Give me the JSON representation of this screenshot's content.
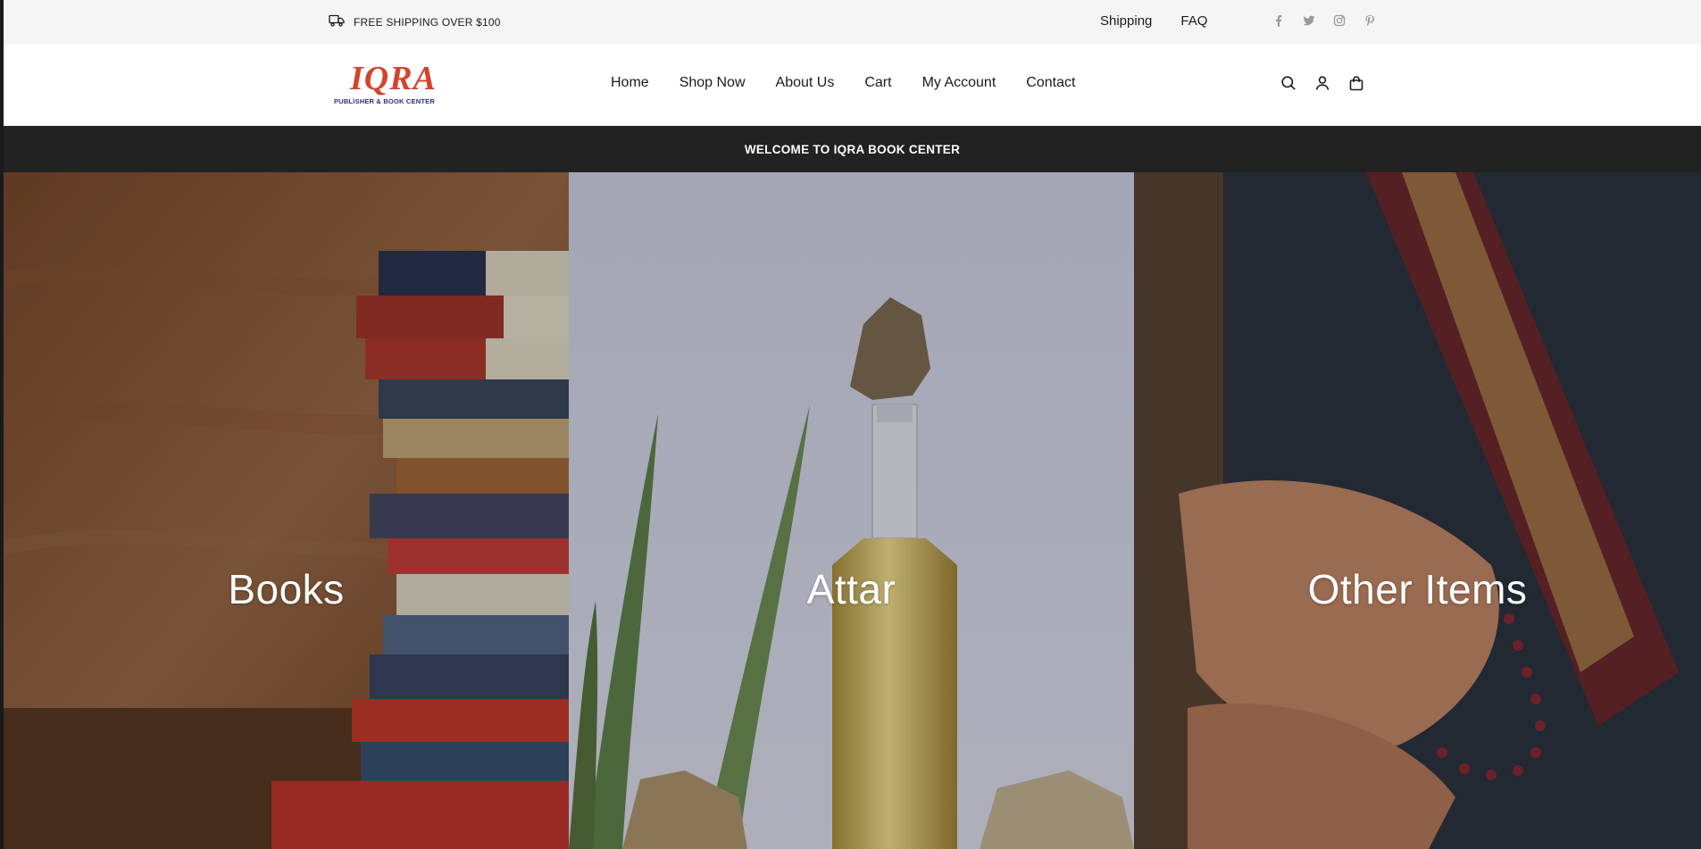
{
  "topbar": {
    "shipping_text": "FREE SHIPPING OVER $100",
    "links": [
      "Shipping",
      "FAQ"
    ],
    "social_icons": [
      "facebook-icon",
      "twitter-icon",
      "instagram-icon",
      "pinterest-icon"
    ]
  },
  "header": {
    "logo_word": "IQRA",
    "logo_sub": "PUBLISHER & BOOK CENTER",
    "nav": [
      "Home",
      "Shop Now",
      "About Us",
      "Cart",
      "My Account",
      "Contact"
    ],
    "icons": [
      "search-icon",
      "account-icon",
      "bag-icon"
    ]
  },
  "welcome": {
    "text": "WELCOME TO IQRA BOOK CENTER"
  },
  "tiles": [
    {
      "title": "Books"
    },
    {
      "title": "Attar"
    },
    {
      "title": "Other Items"
    }
  ],
  "colors": {
    "topbar_bg": "#f5f5f5",
    "welcome_bg": "#222222",
    "logo_red": "#d0452f",
    "logo_blue": "#2c2f7a"
  }
}
